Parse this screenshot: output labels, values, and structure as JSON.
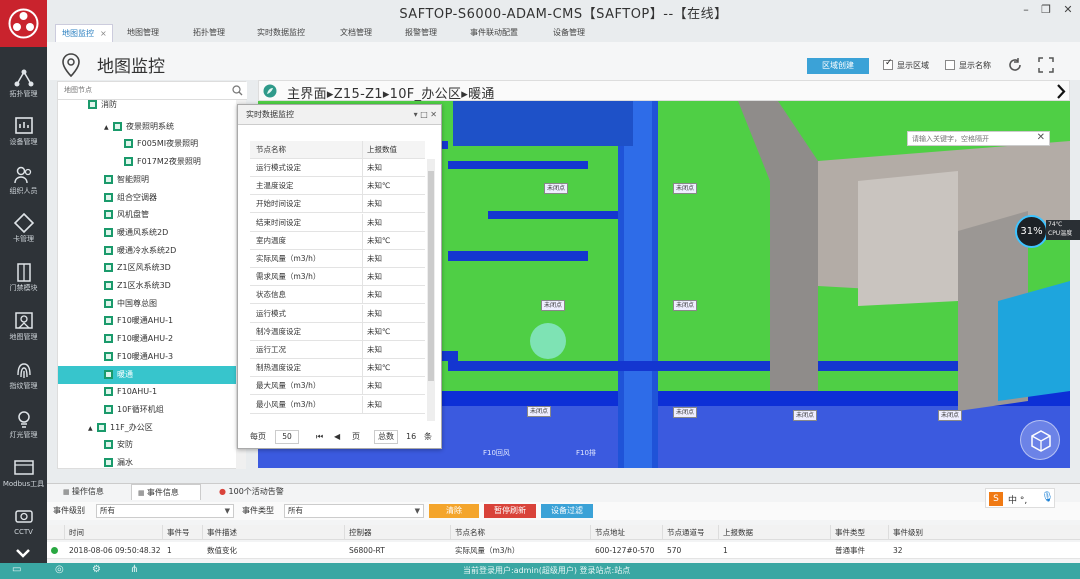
{
  "window": {
    "title": "SAFTOP-S6000-ADAM-CMS【SAFTOP】--【在线】"
  },
  "rail": {
    "items": [
      {
        "label": "拓扑管理",
        "icon": "topology-icon"
      },
      {
        "label": "设备管理",
        "icon": "device-icon"
      },
      {
        "label": "组织人员",
        "icon": "people-icon"
      },
      {
        "label": "卡管理",
        "icon": "card-icon"
      },
      {
        "label": "门禁模块",
        "icon": "door-icon"
      },
      {
        "label": "地图管理",
        "icon": "map-icon"
      },
      {
        "label": "指纹管理",
        "icon": "fingerprint-icon"
      },
      {
        "label": "灯光管理",
        "icon": "light-icon"
      },
      {
        "label": "Modbus工具",
        "icon": "modbus-icon"
      },
      {
        "label": "CCTV",
        "icon": "camera-icon"
      }
    ]
  },
  "tabs": [
    {
      "label": "地图监控",
      "active": true
    },
    {
      "label": "地图管理"
    },
    {
      "label": "拓扑管理"
    },
    {
      "label": "实时数据监控"
    },
    {
      "label": "文档管理"
    },
    {
      "label": "报警管理"
    },
    {
      "label": "事件联动配置"
    },
    {
      "label": "设备管理"
    }
  ],
  "header": {
    "title": "地图监控",
    "region_button": "区域创建",
    "show_region": "显示区域",
    "show_name": "显示名称",
    "show_region_checked": true,
    "show_name_checked": false
  },
  "tree": {
    "search_placeholder": "地图节点",
    "rows": [
      {
        "label": "消防",
        "depth": 2,
        "toggle": "",
        "partial": true
      },
      {
        "label": "夜景照明系统",
        "depth": 3,
        "toggle": "▲"
      },
      {
        "label": "F005MI夜景照明",
        "depth": 4
      },
      {
        "label": "F017M2夜景照明",
        "depth": 4
      },
      {
        "label": "智能照明",
        "depth": 3
      },
      {
        "label": "组合空调器",
        "depth": 3
      },
      {
        "label": "风机盘管",
        "depth": 3
      },
      {
        "label": "暖通风系统2D",
        "depth": 3
      },
      {
        "label": "暖通冷水系统2D",
        "depth": 3
      },
      {
        "label": "Z1区风系统3D",
        "depth": 3
      },
      {
        "label": "Z1区水系统3D",
        "depth": 3
      },
      {
        "label": "中国尊总图",
        "depth": 3
      },
      {
        "label": "F10暖通AHU-1",
        "depth": 3
      },
      {
        "label": "F10暖通AHU-2",
        "depth": 3
      },
      {
        "label": "F10暖通AHU-3",
        "depth": 3
      },
      {
        "label": "暖通",
        "depth": 3,
        "selected": true
      },
      {
        "label": "F10AHU-1",
        "depth": 3
      },
      {
        "label": "10F循环机组",
        "depth": 3
      },
      {
        "label": "11F_办公区",
        "depth": 2,
        "toggle": "▲"
      },
      {
        "label": "安防",
        "depth": 3
      },
      {
        "label": "漏水",
        "depth": 3
      }
    ]
  },
  "breadcrumb": {
    "text": "主界面▸Z15-Z1▸10F_办公区▸暖通"
  },
  "popup": {
    "title": "实时数据监控",
    "col_name": "节点名称",
    "col_value": "上报数值",
    "rows": [
      {
        "name": "运行模式设定",
        "value": "未知"
      },
      {
        "name": "主温度设定",
        "value": "未知℃"
      },
      {
        "name": "开始时间设定",
        "value": "未知"
      },
      {
        "name": "结束时间设定",
        "value": "未知"
      },
      {
        "name": "室内温度",
        "value": "未知℃"
      },
      {
        "name": "实际风量（m3/h）",
        "value": "未知"
      },
      {
        "name": "需求风量（m3/h）",
        "value": "未知"
      },
      {
        "name": "状态信息",
        "value": "未知"
      },
      {
        "name": "运行模式",
        "value": "未知"
      },
      {
        "name": "制冷温度设定",
        "value": "未知℃"
      },
      {
        "name": "运行工况",
        "value": "未知"
      },
      {
        "name": "制热温度设定",
        "value": "未知℃"
      },
      {
        "name": "最大风量（m3/h）",
        "value": "未知"
      },
      {
        "name": "最小风量（m3/h）",
        "value": "未知"
      }
    ],
    "pager": {
      "per_page_label": "每页",
      "per_page": "50",
      "page_label": "页",
      "total_label": "总数",
      "total": "16",
      "unit": "条"
    }
  },
  "scene": {
    "search_placeholder": "请输入关键字，空格隔开",
    "cpu": "31%",
    "cpu_temp": "74℃",
    "cpu_label": "CPU温度",
    "zone_labels": [
      "F10回风",
      "F10排"
    ],
    "markers": [
      "未闭点",
      "未闭点",
      "未闭点",
      "未闭点",
      "未闭点",
      "未闭点",
      "未闭点",
      "未闭点"
    ]
  },
  "bottom": {
    "tabs": [
      {
        "label": "操作信息"
      },
      {
        "label": "事件信息",
        "active": true
      },
      {
        "label": "100个活动告警"
      }
    ],
    "filters": {
      "level_label": "事件级别",
      "level_value": "所有",
      "type_label": "事件类型",
      "type_value": "所有",
      "btn_clear": "清除",
      "btn_pause": "暂停刷新",
      "btn_filter": "设备过滤"
    },
    "columns": [
      "时间",
      "事件号",
      "事件描述",
      "控制器",
      "节点名称",
      "节点地址",
      "节点通道号",
      "上报数据",
      "事件类型",
      "事件级别"
    ],
    "row": [
      "2018-08-06 09:50:48.32",
      "1",
      "数值变化",
      "S6800-RT",
      "实际风量（m3/h）",
      "600-127#0-570",
      "570",
      "1",
      "普通事件",
      "32"
    ],
    "colors": {
      "clear": "#f4a52c",
      "pause": "#d9433a",
      "filter": "#3ba2d7"
    }
  },
  "ime": {
    "text": "中 °,"
  },
  "status": {
    "text": "当前登录用户:admin(超级用户)   登录站点:站点"
  }
}
